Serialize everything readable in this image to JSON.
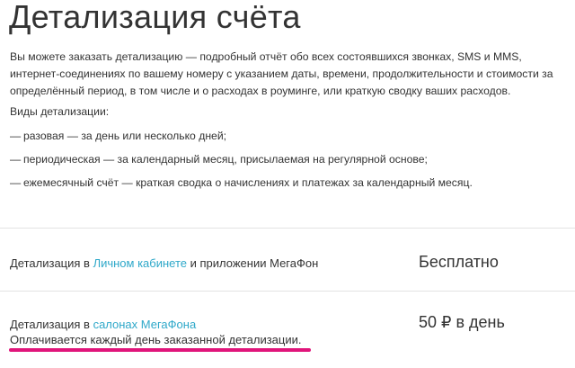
{
  "page": {
    "title": "Детализация счёта",
    "intro": "Вы можете заказать детализацию — подробный отчёт обо всех состоявшихся звонках, SMS и MMS, интернет-соединениях по вашему номеру с указанием даты, времени, продолжительности и стоимости за определённый период, в том числе и о расходах в роуминге, или краткую сводку ваших расходов.",
    "types_label": "Виды детализации:",
    "types": [
      "разовая — за день или несколько дней;",
      "периодическая — за календарный месяц, присылаемая на регулярной основе;",
      "ежемесячный счёт — краткая сводка о начислениях и платежах за календарный месяц."
    ]
  },
  "list_bullet": "—",
  "pricing": [
    {
      "prefix": "Детализация в ",
      "link": "Личном кабинете",
      "suffix": " и приложении МегаФон",
      "price": "Бесплатно"
    },
    {
      "prefix": "Детализация в ",
      "link": "салонах МегаФона",
      "suffix": "",
      "price": "50 ₽ в день",
      "note": "Оплачивается каждый день заказанной детализации."
    }
  ],
  "colors": {
    "text": "#333333",
    "link": "#2ea8c9",
    "highlight": "#e0157a",
    "divider": "#e3e3e3"
  }
}
